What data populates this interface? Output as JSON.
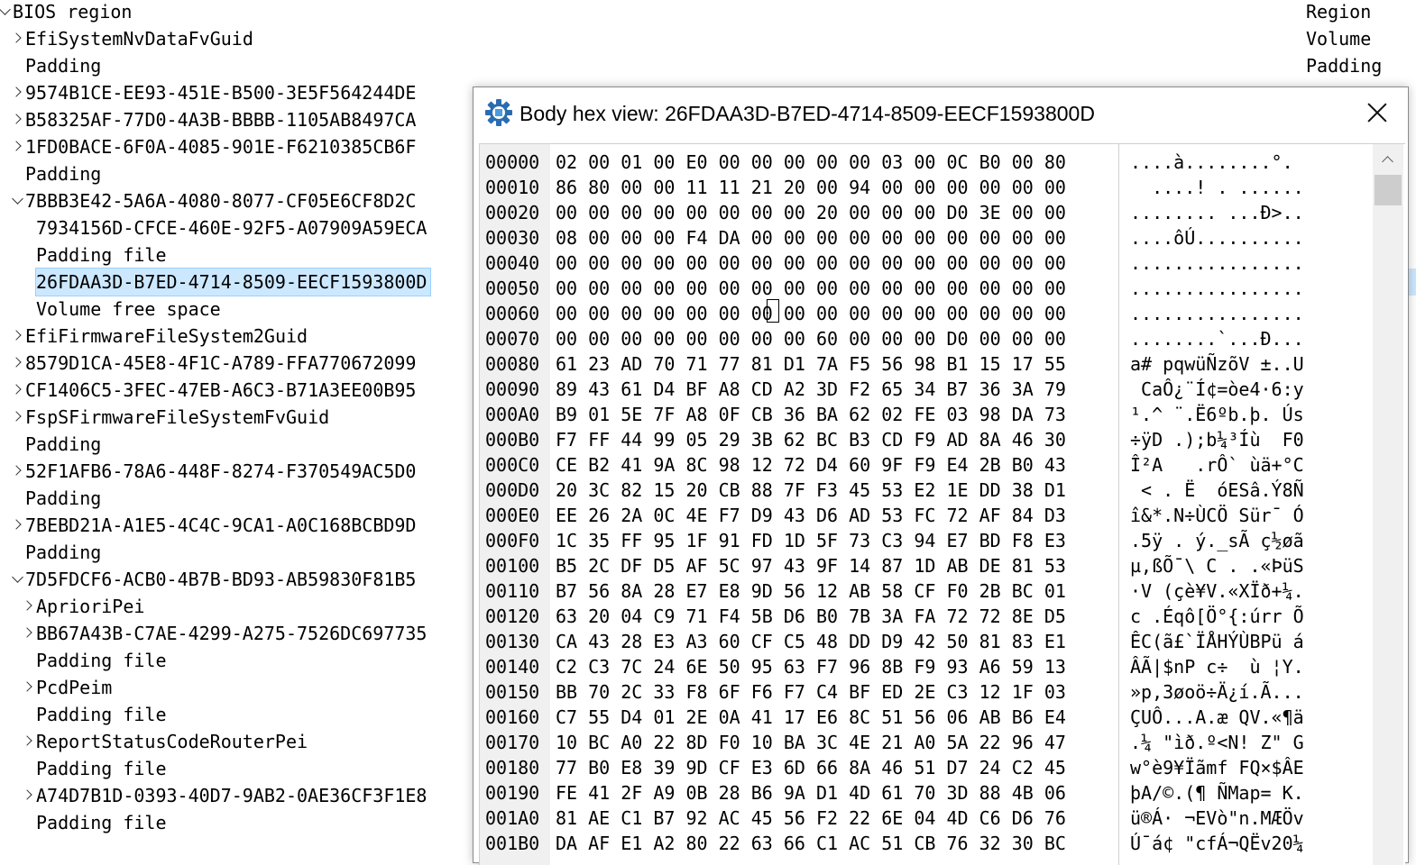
{
  "tree": {
    "items": [
      {
        "label": "BIOS region",
        "state": "open",
        "indent": 0
      },
      {
        "label": "EfiSystemNvDataFvGuid",
        "state": "closed",
        "indent": 1
      },
      {
        "label": "Padding",
        "state": "none",
        "indent": 1
      },
      {
        "label": "9574B1CE-EE93-451E-B500-3E5F564244DE",
        "state": "closed",
        "indent": 1
      },
      {
        "label": "B58325AF-77D0-4A3B-BBBB-1105AB8497CA",
        "state": "closed",
        "indent": 1
      },
      {
        "label": "1FD0BACE-6F0A-4085-901E-F6210385CB6F",
        "state": "closed",
        "indent": 1
      },
      {
        "label": "Padding",
        "state": "none",
        "indent": 1
      },
      {
        "label": "7BBB3E42-5A6A-4080-8077-CF05E6CF8D2C",
        "state": "open",
        "indent": 1
      },
      {
        "label": "7934156D-CFCE-460E-92F5-A07909A59ECA",
        "state": "none",
        "indent": 2
      },
      {
        "label": "Padding file",
        "state": "none",
        "indent": 2
      },
      {
        "label": "26FDAA3D-B7ED-4714-8509-EECF1593800D",
        "state": "none",
        "indent": 2,
        "selected": true
      },
      {
        "label": "Volume free space",
        "state": "none",
        "indent": 2
      },
      {
        "label": "EfiFirmwareFileSystem2Guid",
        "state": "closed",
        "indent": 1
      },
      {
        "label": "8579D1CA-45E8-4F1C-A789-FFA770672099",
        "state": "closed",
        "indent": 1
      },
      {
        "label": "CF1406C5-3FEC-47EB-A6C3-B71A3EE00B95",
        "state": "closed",
        "indent": 1
      },
      {
        "label": "FspSFirmwareFileSystemFvGuid",
        "state": "closed",
        "indent": 1
      },
      {
        "label": "Padding",
        "state": "none",
        "indent": 1
      },
      {
        "label": "52F1AFB6-78A6-448F-8274-F370549AC5D0",
        "state": "closed",
        "indent": 1
      },
      {
        "label": "Padding",
        "state": "none",
        "indent": 1
      },
      {
        "label": "7BEBD21A-A1E5-4C4C-9CA1-A0C168BCBD9D",
        "state": "closed",
        "indent": 1
      },
      {
        "label": "Padding",
        "state": "none",
        "indent": 1
      },
      {
        "label": "7D5FDCF6-ACB0-4B7B-BD93-AB59830F81B5",
        "state": "open",
        "indent": 1
      },
      {
        "label": "AprioriPei",
        "state": "closed",
        "indent": 2
      },
      {
        "label": "BB67A43B-C7AE-4299-A275-7526DC697735",
        "state": "closed",
        "indent": 2
      },
      {
        "label": "Padding file",
        "state": "none",
        "indent": 2
      },
      {
        "label": "PcdPeim",
        "state": "closed",
        "indent": 2
      },
      {
        "label": "Padding file",
        "state": "none",
        "indent": 2
      },
      {
        "label": "ReportStatusCodeRouterPei",
        "state": "closed",
        "indent": 2
      },
      {
        "label": "Padding file",
        "state": "none",
        "indent": 2
      },
      {
        "label": "A74D7B1D-0393-40D7-9AB2-0AE36CF3F1E8",
        "state": "closed",
        "indent": 2
      },
      {
        "label": "Padding file",
        "state": "none",
        "indent": 2
      }
    ]
  },
  "type_column": [
    "Region",
    "Volume",
    "Padding"
  ],
  "dialog": {
    "title": "Body hex view: 26FDAA3D-B7ED-4714-8509-EECF1593800D",
    "icon": "uefitool-gear-icon",
    "hex_rows": [
      {
        "addr": "00000",
        "hex": "02 00 01 00 E0 00 00 00 00 00 03 00 0C B0 00 80",
        "ascii": "....à........°."
      },
      {
        "addr": "00010",
        "hex": "86 80 00 00 11 11 21 20 00 94 00 00 00 00 00 00",
        "ascii": "  ....! . ......"
      },
      {
        "addr": "00020",
        "hex": "00 00 00 00 00 00 00 00 20 00 00 00 D0 3E 00 00",
        "ascii": "........ ...Ð>.."
      },
      {
        "addr": "00030",
        "hex": "08 00 00 00 F4 DA 00 00 00 00 00 00 00 00 00 00",
        "ascii": "....ôÚ.........."
      },
      {
        "addr": "00040",
        "hex": "00 00 00 00 00 00 00 00 00 00 00 00 00 00 00 00",
        "ascii": "................"
      },
      {
        "addr": "00050",
        "hex": "00 00 00 00 00 00 00 00 00 00 00 00 00 00 00 00",
        "ascii": "................"
      },
      {
        "addr": "00060",
        "hex": "00 00 00 00 00 00 00 00 00 00 00 00 00 00 00 00",
        "ascii": "................"
      },
      {
        "addr": "00070",
        "hex": "00 00 00 00 00 00 00 00 60 00 00 00 D0 00 00 00",
        "ascii": "........`...Ð..."
      },
      {
        "addr": "00080",
        "hex": "61 23 AD 70 71 77 81 D1 7A F5 56 98 B1 15 17 55",
        "ascii": "a# pqwüÑzõV ±..U"
      },
      {
        "addr": "00090",
        "hex": "89 43 61 D4 BF A8 CD A2 3D F2 65 34 B7 36 3A 79",
        "ascii": " CaÔ¿¨Í¢=òe4·6:y"
      },
      {
        "addr": "000A0",
        "hex": "B9 01 5E 7F A8 0F CB 36 BA 62 02 FE 03 98 DA 73",
        "ascii": "¹.^ ¨.Ë6ºb.þ. Ús"
      },
      {
        "addr": "000B0",
        "hex": "F7 FF 44 99 05 29 3B 62 BC B3 CD F9 AD 8A 46 30",
        "ascii": "÷ÿD .);b¼³Íù  F0"
      },
      {
        "addr": "000C0",
        "hex": "CE B2 41 9A 8C 98 12 72 D4 60 9F F9 E4 2B B0 43",
        "ascii": "Î²A   .rÔ` ùä+°C"
      },
      {
        "addr": "000D0",
        "hex": "20 3C 82 15 20 CB 88 7F F3 45 53 E2 1E DD 38 D1",
        "ascii": " < . Ë  óESâ.Ý8Ñ"
      },
      {
        "addr": "000E0",
        "hex": "EE 26 2A 0C 4E F7 D9 43 D6 AD 53 FC 72 AF 84 D3",
        "ascii": "î&*.N÷ÙCÖ Sür¯ Ó"
      },
      {
        "addr": "000F0",
        "hex": "1C 35 FF 95 1F 91 FD 1D 5F 73 C3 94 E7 BD F8 E3",
        "ascii": ".5ÿ . ý._sÃ ç½øã"
      },
      {
        "addr": "00100",
        "hex": "B5 2C DF D5 AF 5C 97 43 9F 14 87 1D AB DE 81 53",
        "ascii": "µ,ßÕ¯\\ C . .«ÞüS"
      },
      {
        "addr": "00110",
        "hex": "B7 56 8A 28 E7 E8 9D 56 12 AB 58 CF F0 2B BC 01",
        "ascii": "·V (çè¥V.«XÏð+¼."
      },
      {
        "addr": "00120",
        "hex": "63 20 04 C9 71 F4 5B D6 B0 7B 3A FA 72 72 8E D5",
        "ascii": "c .Éqô[Ö°{:úrr Õ"
      },
      {
        "addr": "00130",
        "hex": "CA 43 28 E3 A3 60 CF C5 48 DD D9 42 50 81 83 E1",
        "ascii": "ÊC(ã£`ÏÅHÝÙBPü á"
      },
      {
        "addr": "00140",
        "hex": "C2 C3 7C 24 6E 50 95 63 F7 96 8B F9 93 A6 59 13",
        "ascii": "ÂÃ|$nP c÷  ù ¦Y."
      },
      {
        "addr": "00150",
        "hex": "BB 70 2C 33 F8 6F F6 F7 C4 BF ED 2E C3 12 1F 03",
        "ascii": "»p,3øoö÷Ä¿í.Ã..."
      },
      {
        "addr": "00160",
        "hex": "C7 55 D4 01 2E 0A 41 17 E6 8C 51 56 06 AB B6 E4",
        "ascii": "ÇUÔ...A.æ QV.«¶ä"
      },
      {
        "addr": "00170",
        "hex": "10 BC A0 22 8D F0 10 BA 3C 4E 21 A0 5A 22 96 47",
        "ascii": ".¼ \"ìð.º<N! Z\" G"
      },
      {
        "addr": "00180",
        "hex": "77 B0 E8 39 9D CF E3 6D 66 8A 46 51 D7 24 C2 45",
        "ascii": "w°è9¥Ïãmf FQ×$ÂE"
      },
      {
        "addr": "00190",
        "hex": "FE 41 2F A9 0B 28 B6 9A D1 4D 61 70 3D 88 4B 06",
        "ascii": "þA/©.(¶ ÑMap= K."
      },
      {
        "addr": "001A0",
        "hex": "81 AE C1 B7 92 AC 45 56 F2 22 6E 04 4D C6 D6 76",
        "ascii": "ü®Á· ¬EVò\"n.MÆÖv"
      },
      {
        "addr": "001B0",
        "hex": "DA AF E1 A2 80 22 63 66 C1 AC 51 CB 76 32 30 BC",
        "ascii": "Ú¯á¢ \"cfÁ¬QËv20¼"
      }
    ]
  }
}
